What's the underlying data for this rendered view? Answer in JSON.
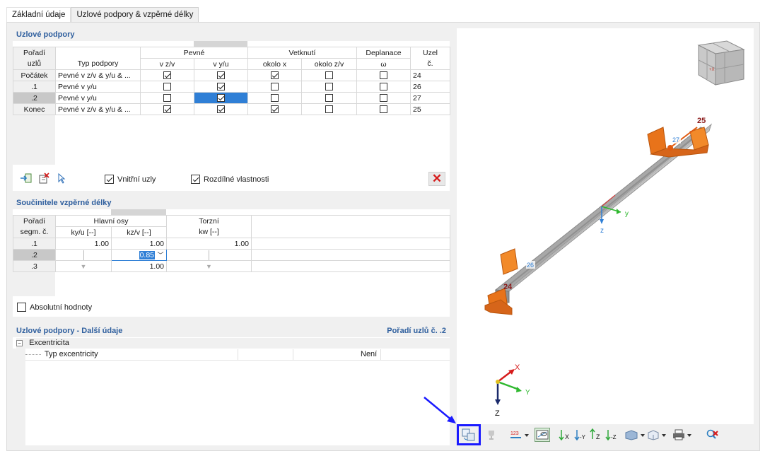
{
  "tabs": [
    {
      "label": "Základní údaje"
    },
    {
      "label": "Uzlové podpory & vzpěrné délky"
    }
  ],
  "supports": {
    "title": "Uzlové podpory",
    "headers": {
      "order_line1": "Pořadí",
      "order_line2": "uzlů",
      "type": "Typ podpory",
      "fixed": "Pevné",
      "fixed_zv": "v z/v",
      "fixed_yu": "v y/u",
      "rot": "Vetknutí",
      "rot_x": "okolo x",
      "rot_zv": "okolo z/v",
      "warp": "Deplanace",
      "warp_w": "ω",
      "node_line1": "Uzel",
      "node_line2": "č."
    },
    "rows": [
      {
        "order": "Počátek",
        "type": "Pevné v z/v & y/u & ...",
        "fz": true,
        "fy": true,
        "rx": true,
        "rz": false,
        "w": false,
        "node": "24"
      },
      {
        "order": ".1",
        "type": "Pevné v y/u",
        "fz": false,
        "fy": true,
        "rx": false,
        "rz": false,
        "w": false,
        "node": "26"
      },
      {
        "order": ".2",
        "type": "Pevné v y/u",
        "fz": false,
        "fy": true,
        "rx": false,
        "rz": false,
        "w": false,
        "node": "27"
      },
      {
        "order": "Konec",
        "type": "Pevné v z/v & y/u & ...",
        "fz": true,
        "fy": true,
        "rx": true,
        "rz": false,
        "w": false,
        "node": "25"
      }
    ],
    "opt_inner_nodes": "Vnitřní uzly",
    "opt_different": "Rozdílné vlastnosti"
  },
  "buckling": {
    "title": "Součinitele vzpěrné délky",
    "headers": {
      "seg_line1": "Pořadí",
      "seg_line2": "segm. č.",
      "main": "Hlavní osy",
      "ky": "ky/u [--]",
      "kz": "kz/v [--]",
      "torsion": "Torzní",
      "kw": "kw [--]"
    },
    "rows": [
      {
        "seg": ".1",
        "ky": "1.00",
        "kz": "1.00",
        "kw": "1.00"
      },
      {
        "seg": ".2",
        "ky": "",
        "kz": "0.85",
        "kw": ""
      },
      {
        "seg": ".3",
        "ky": "",
        "kz": "1.00",
        "kw": ""
      }
    ],
    "opt_absolute": "Absolutní hodnoty"
  },
  "details": {
    "title": "Uzlové podpory - Další údaje",
    "right_title": "Pořadí uzlů č. .2",
    "group": "Excentricita",
    "item_label": "Typ excentricity",
    "item_value": "Není"
  },
  "view": {
    "node_labels": {
      "n24": "24",
      "n25": "25",
      "n26": "26",
      "n27": "27"
    },
    "axes": {
      "y": "y",
      "z": "z",
      "X": "X",
      "Y": "Y",
      "Z": "Z"
    }
  },
  "colors": {
    "accent": "#2f7fd6",
    "title_blue": "#2f5f9e",
    "support_orange": "#f07d1a",
    "highlight_border": "#1a1aff",
    "delete_red": "#d61b1b"
  }
}
